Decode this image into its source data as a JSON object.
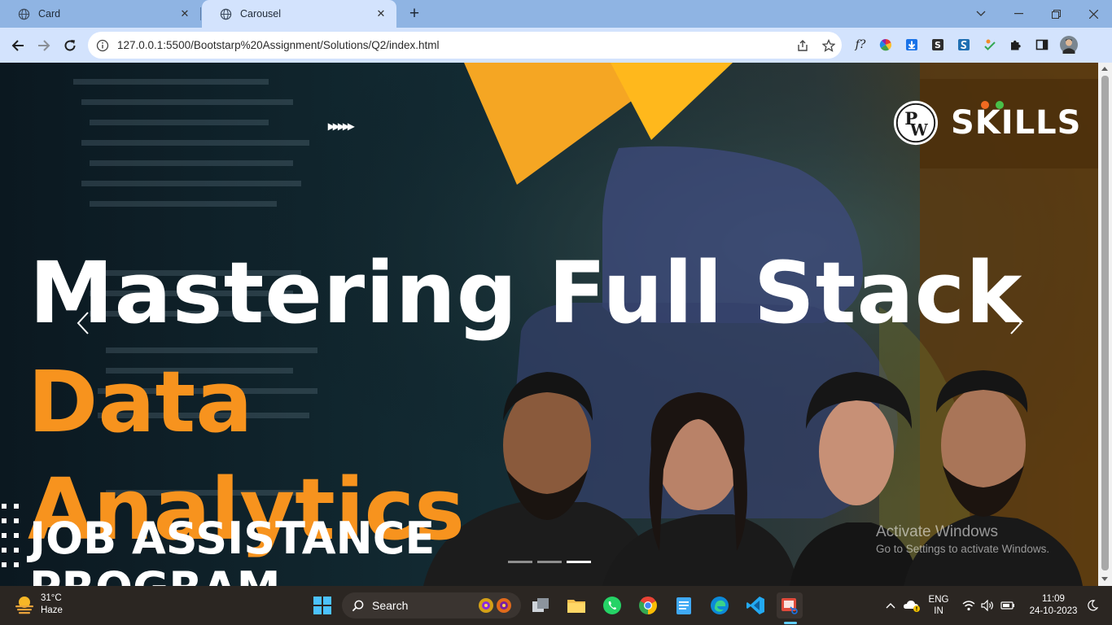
{
  "browser": {
    "tabs": [
      {
        "title": "Card",
        "active": false
      },
      {
        "title": "Carousel",
        "active": true
      }
    ],
    "url": "127.0.0.1:5500/Bootstarp%20Assignment/Solutions/Q2/index.html"
  },
  "slide": {
    "logo_text": "SKILLS",
    "logo_mark": "PW",
    "line1": "Mastering Full Stack",
    "line2": "Data",
    "line3": "Analytics",
    "line4": "JOB ASSISTANCE",
    "line5": "PROGRAM",
    "deco_arrows": "▸▸▸▸▸",
    "active_indicator": 3,
    "indicator_count": 3
  },
  "watermark": {
    "line1": "Activate Windows",
    "line2": "Go to Settings to activate Windows."
  },
  "taskbar": {
    "weather_temp": "31°C",
    "weather_desc": "Haze",
    "search_label": "Search",
    "lang_line1": "ENG",
    "lang_line2": "IN",
    "time": "11:09",
    "date": "24-10-2023"
  },
  "colors": {
    "accent_orange": "#f7931e",
    "tab_active": "#d3e3fd",
    "tabstrip": "#8fb4e3"
  }
}
